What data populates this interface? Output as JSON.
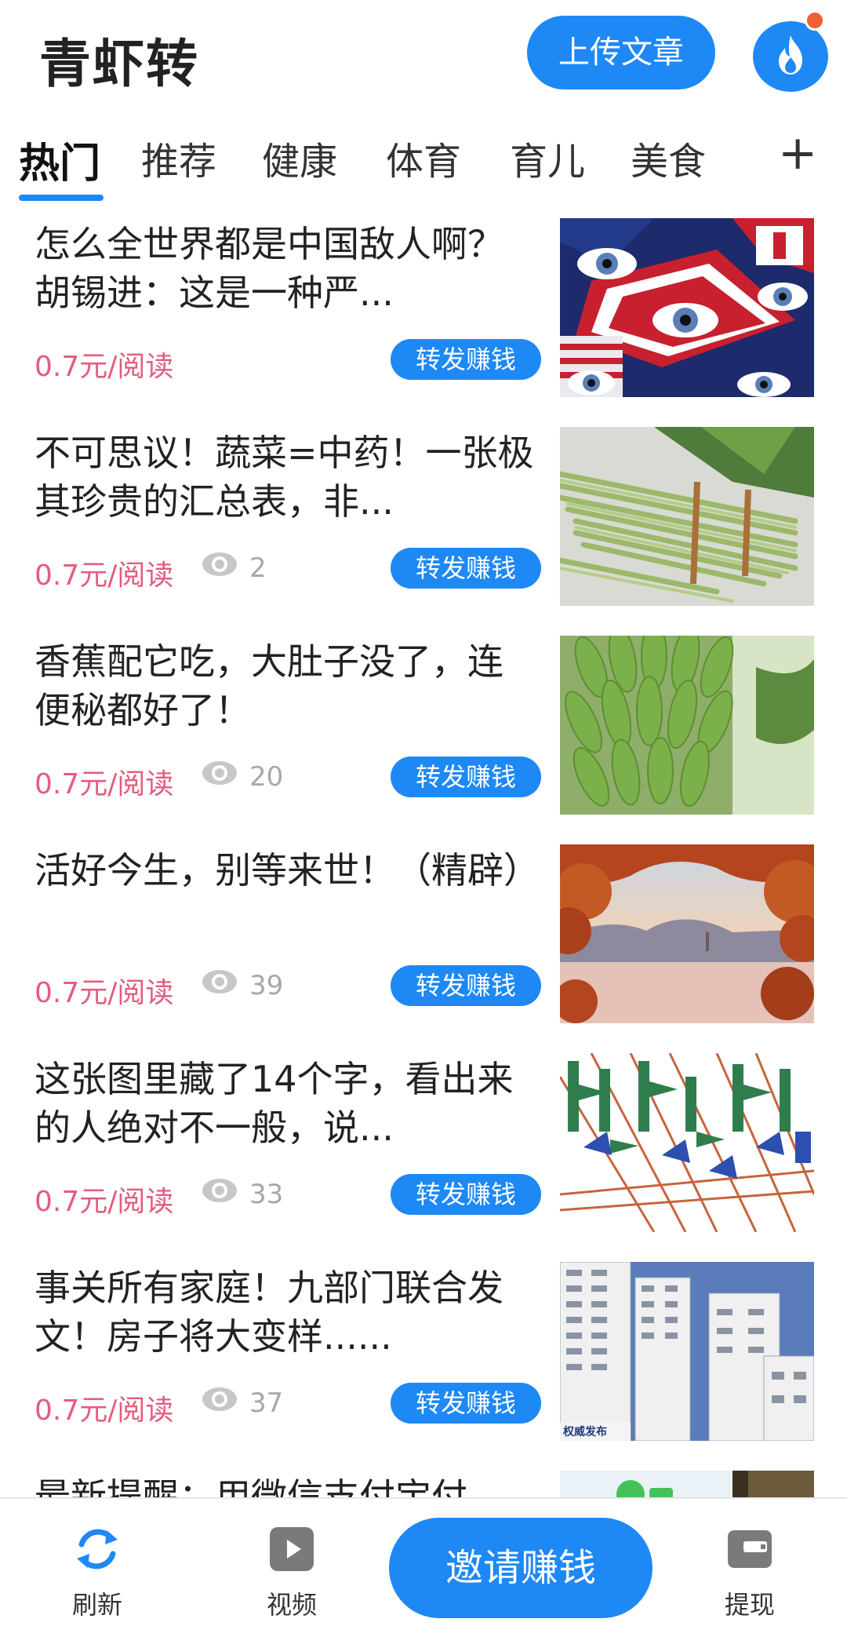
{
  "header": {
    "app_title": "青虾转",
    "upload_label": "上传文章"
  },
  "tabs": {
    "items": [
      "热门",
      "推荐",
      "健康",
      "体育",
      "育儿",
      "美食"
    ],
    "active_index": 0,
    "add_icon": "plus-icon"
  },
  "feed": {
    "items": [
      {
        "title": "怎么全世界都是中国敌人啊？胡锡进：这是一种严...",
        "price": "0.7元/阅读",
        "views": "",
        "share_label": "转发赚钱",
        "thumb": "flags-eyes"
      },
      {
        "title": "不可思议！蔬菜=中药！一张极其珍贵的汇总表，非...",
        "price": "0.7元/阅读",
        "views": "2",
        "share_label": "转发赚钱",
        "thumb": "green-beans"
      },
      {
        "title": "香蕉配它吃，大肚子没了，连便秘都好了！",
        "price": "0.7元/阅读",
        "views": "20",
        "share_label": "转发赚钱",
        "thumb": "bananas"
      },
      {
        "title": "活好今生，别等来世！（精辟）",
        "price": "0.7元/阅读",
        "views": "39",
        "share_label": "转发赚钱",
        "thumb": "lake-autumn"
      },
      {
        "title": "这张图里藏了14个字，看出来的人绝对不一般，说...",
        "price": "0.7元/阅读",
        "views": "33",
        "share_label": "转发赚钱",
        "thumb": "hidden-words"
      },
      {
        "title": "事关所有家庭！九部门联合发文！房子将大变样......",
        "price": "0.7元/阅读",
        "views": "37",
        "share_label": "转发赚钱",
        "thumb": "buildings",
        "thumb_caption": "权威发布"
      },
      {
        "title": "最新提醒：用微信支付宝付",
        "price": "",
        "views": "",
        "share_label": "",
        "thumb": "wechat-pay"
      }
    ]
  },
  "bottom_nav": {
    "refresh_label": "刷新",
    "video_label": "视频",
    "invite_label": "邀请赚钱",
    "withdraw_label": "提现"
  },
  "colors": {
    "accent": "#1e88f5",
    "price": "#e35d7e",
    "notification": "#f06030"
  }
}
